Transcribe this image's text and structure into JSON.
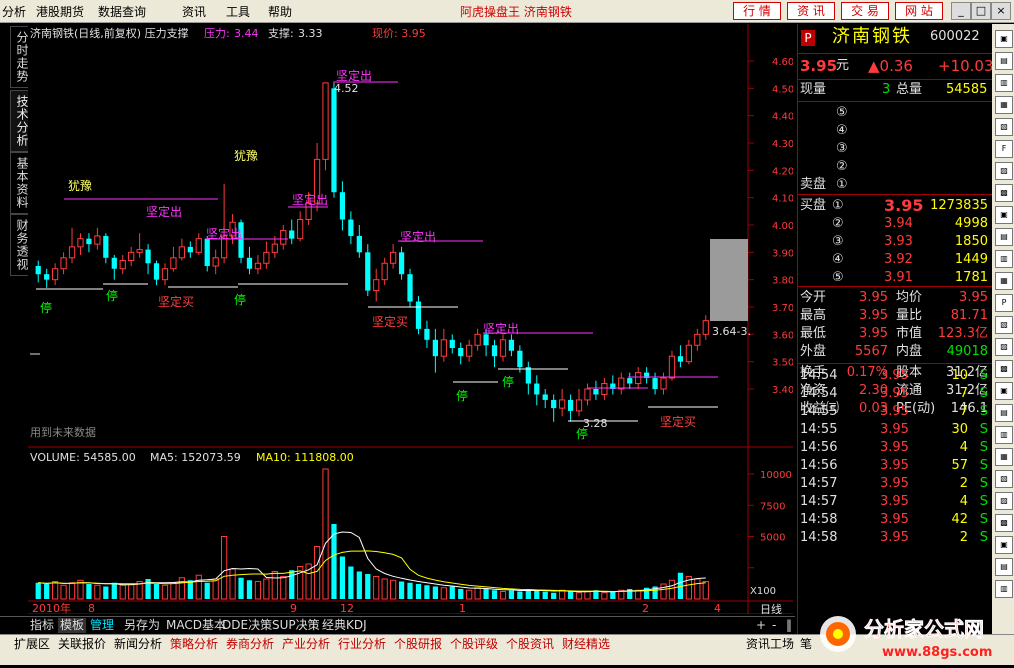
{
  "menu": {
    "items": [
      "分析",
      "港股期货",
      "数据查询",
      "资讯",
      "工具",
      "帮助"
    ],
    "center_title": "阿虎操盘王  济南钢铁",
    "buttons": [
      "行 情",
      "资 讯",
      "交 易",
      "网 站"
    ],
    "window_buttons": [
      "_",
      "□",
      "×"
    ]
  },
  "left_tabs": [
    "分时走势",
    "技术分析",
    "基本资料",
    "财务透视"
  ],
  "chart_header": {
    "title": "济南钢铁(日线,前复权) 压力支撑",
    "pressure_label": "压力:",
    "pressure_value": "3.44",
    "support_label": "支撑:",
    "support_value": "3.33",
    "price_label": "现价: 3.95"
  },
  "chart_annotations": {
    "high_label": "4.52",
    "low_label": "3.28",
    "right_label": "3.64-3.",
    "future_note": "用到未来数据",
    "signals": [
      "坚定出",
      "坚定出",
      "坚定出",
      "坚定出",
      "坚定出",
      "坚定出",
      "坚定买",
      "坚定买",
      "坚定买",
      "停",
      "停",
      "停",
      "停",
      "停",
      "停",
      "犹豫",
      "犹豫"
    ]
  },
  "volume_header": {
    "volume": "VOLUME: 54585.00",
    "ma5": "MA5: 152073.59",
    "ma10": "MA10: 111808.00",
    "scale_label": "X100"
  },
  "time_axis": {
    "labels": [
      "2010年",
      "8",
      "9",
      "12",
      "1",
      "2",
      "4"
    ],
    "period": "日线"
  },
  "chart_data": {
    "type": "candlestick",
    "price_ticks": [
      4.6,
      4.5,
      4.4,
      4.3,
      4.2,
      4.1,
      4.0,
      3.9,
      3.8,
      3.7,
      3.6,
      3.5,
      3.4
    ],
    "volume_ticks": [
      10000,
      7500,
      5000,
      2500
    ],
    "candles": [
      [
        3.85,
        3.82,
        3.87,
        3.79
      ],
      [
        3.82,
        3.8,
        3.84,
        3.77
      ],
      [
        3.8,
        3.84,
        3.86,
        3.78
      ],
      [
        3.84,
        3.88,
        3.9,
        3.82
      ],
      [
        3.88,
        3.92,
        3.99,
        3.86
      ],
      [
        3.92,
        3.95,
        3.97,
        3.89
      ],
      [
        3.95,
        3.93,
        3.97,
        3.9
      ],
      [
        3.93,
        3.96,
        3.99,
        3.91
      ],
      [
        3.96,
        3.88,
        3.97,
        3.86
      ],
      [
        3.88,
        3.84,
        3.89,
        3.8
      ],
      [
        3.84,
        3.87,
        3.89,
        3.82
      ],
      [
        3.87,
        3.9,
        3.92,
        3.85
      ],
      [
        3.9,
        3.91,
        3.97,
        3.88
      ],
      [
        3.91,
        3.86,
        3.93,
        3.82
      ],
      [
        3.86,
        3.8,
        3.87,
        3.78
      ],
      [
        3.8,
        3.84,
        3.86,
        3.78
      ],
      [
        3.84,
        3.88,
        3.92,
        3.83
      ],
      [
        3.88,
        3.92,
        3.95,
        3.87
      ],
      [
        3.92,
        3.9,
        3.94,
        3.88
      ],
      [
        3.9,
        3.95,
        3.97,
        3.89
      ],
      [
        3.95,
        3.85,
        3.96,
        3.83
      ],
      [
        3.85,
        3.88,
        3.91,
        3.82
      ],
      [
        3.88,
        3.96,
        4.15,
        3.86
      ],
      [
        3.96,
        4.01,
        4.04,
        3.93
      ],
      [
        4.01,
        3.88,
        4.02,
        3.86
      ],
      [
        3.88,
        3.84,
        3.92,
        3.82
      ],
      [
        3.84,
        3.86,
        3.89,
        3.82
      ],
      [
        3.86,
        3.9,
        3.94,
        3.84
      ],
      [
        3.9,
        3.93,
        3.96,
        3.88
      ],
      [
        3.93,
        3.98,
        4.0,
        3.91
      ],
      [
        3.98,
        3.95,
        4.02,
        3.93
      ],
      [
        3.95,
        4.02,
        4.05,
        3.94
      ],
      [
        4.02,
        4.08,
        4.12,
        4.0
      ],
      [
        4.08,
        4.24,
        4.3,
        4.05
      ],
      [
        4.24,
        4.52,
        4.52,
        4.2
      ],
      [
        4.5,
        4.12,
        4.52,
        4.1
      ],
      [
        4.12,
        4.02,
        4.16,
        3.98
      ],
      [
        4.02,
        3.96,
        4.05,
        3.93
      ],
      [
        3.96,
        3.9,
        4.0,
        3.88
      ],
      [
        3.9,
        3.76,
        3.93,
        3.74
      ],
      [
        3.76,
        3.8,
        3.84,
        3.72
      ],
      [
        3.8,
        3.86,
        3.88,
        3.78
      ],
      [
        3.86,
        3.9,
        3.93,
        3.84
      ],
      [
        3.9,
        3.82,
        3.92,
        3.8
      ],
      [
        3.82,
        3.72,
        3.84,
        3.7
      ],
      [
        3.72,
        3.62,
        3.74,
        3.6
      ],
      [
        3.62,
        3.58,
        3.65,
        3.55
      ],
      [
        3.58,
        3.52,
        3.62,
        3.46
      ],
      [
        3.52,
        3.58,
        3.62,
        3.5
      ],
      [
        3.58,
        3.55,
        3.6,
        3.53
      ],
      [
        3.55,
        3.52,
        3.57,
        3.49
      ],
      [
        3.52,
        3.56,
        3.58,
        3.5
      ],
      [
        3.56,
        3.6,
        3.62,
        3.54
      ],
      [
        3.6,
        3.56,
        3.62,
        3.52
      ],
      [
        3.56,
        3.52,
        3.58,
        3.48
      ],
      [
        3.52,
        3.58,
        3.6,
        3.5
      ],
      [
        3.58,
        3.54,
        3.6,
        3.52
      ],
      [
        3.54,
        3.48,
        3.56,
        3.46
      ],
      [
        3.48,
        3.42,
        3.5,
        3.38
      ],
      [
        3.42,
        3.38,
        3.45,
        3.34
      ],
      [
        3.38,
        3.36,
        3.4,
        3.33
      ],
      [
        3.36,
        3.33,
        3.38,
        3.28
      ],
      [
        3.33,
        3.36,
        3.4,
        3.3
      ],
      [
        3.36,
        3.32,
        3.38,
        3.28
      ],
      [
        3.32,
        3.36,
        3.4,
        3.3
      ],
      [
        3.36,
        3.4,
        3.42,
        3.34
      ],
      [
        3.4,
        3.38,
        3.43,
        3.36
      ],
      [
        3.38,
        3.42,
        3.44,
        3.36
      ],
      [
        3.42,
        3.4,
        3.45,
        3.38
      ],
      [
        3.4,
        3.44,
        3.46,
        3.38
      ],
      [
        3.44,
        3.42,
        3.46,
        3.4
      ],
      [
        3.42,
        3.46,
        3.48,
        3.4
      ],
      [
        3.46,
        3.44,
        3.48,
        3.42
      ],
      [
        3.44,
        3.4,
        3.46,
        3.38
      ],
      [
        3.4,
        3.44,
        3.46,
        3.38
      ],
      [
        3.44,
        3.52,
        3.54,
        3.43
      ],
      [
        3.52,
        3.5,
        3.56,
        3.48
      ],
      [
        3.5,
        3.56,
        3.58,
        3.49
      ],
      [
        3.56,
        3.6,
        3.62,
        3.54
      ],
      [
        3.6,
        3.65,
        3.67,
        3.58
      ]
    ],
    "volumes": [
      1300,
      1200,
      1400,
      1100,
      1300,
      1500,
      1200,
      1100,
      1000,
      1300,
      1100,
      1200,
      1400,
      1600,
      1200,
      1100,
      1300,
      1700,
      1500,
      1900,
      1300,
      1600,
      5000,
      2400,
      1700,
      1500,
      1400,
      1600,
      2200,
      1800,
      2300,
      2600,
      2800,
      4200,
      10400,
      6000,
      3400,
      2600,
      2200,
      2000,
      1800,
      1600,
      1500,
      1400,
      1300,
      1200,
      1100,
      1000,
      900,
      1000,
      800,
      700,
      900,
      800,
      700,
      600,
      700,
      600,
      800,
      700,
      600,
      500,
      700,
      600,
      500,
      600,
      700,
      500,
      600,
      700,
      800,
      700,
      900,
      1000,
      1200,
      1500,
      2100,
      1800,
      1600,
      1400
    ]
  },
  "quote": {
    "p_label": "P",
    "name": "济南钢铁",
    "code": "600022",
    "price": "3.95",
    "unit": "元",
    "change": "▲0.36",
    "change_pct": "+10.03",
    "now_vol_label": "现量",
    "now_vol": "3",
    "total_vol_label": "总量",
    "total_vol": "54585",
    "sell_label": "卖盘",
    "buy_label": "买盘",
    "sell_levels": [
      "⑤",
      "④",
      "③",
      "②",
      "①"
    ],
    "buy_levels": [
      {
        "lvl": "①",
        "price": "3.95",
        "vol": "1273835"
      },
      {
        "lvl": "②",
        "price": "3.94",
        "vol": "4998"
      },
      {
        "lvl": "③",
        "price": "3.93",
        "vol": "1850"
      },
      {
        "lvl": "④",
        "price": "3.92",
        "vol": "1449"
      },
      {
        "lvl": "⑤",
        "price": "3.91",
        "vol": "1781"
      }
    ],
    "stats": [
      {
        "l1": "今开",
        "v1": "3.95",
        "l2": "均价",
        "v2": "3.95"
      },
      {
        "l1": "最高",
        "v1": "3.95",
        "l2": "量比",
        "v2": "81.71"
      },
      {
        "l1": "最低",
        "v1": "3.95",
        "l2": "市值",
        "v2": "123.3亿"
      },
      {
        "l1": "外盘",
        "v1": "5567",
        "l2": "内盘",
        "v2": "49018"
      },
      {
        "l1": "换手",
        "v1": "0.17%",
        "l2": "股本",
        "v2": "31.2亿"
      },
      {
        "l1": "净资",
        "v1": "2.30",
        "l2": "流通",
        "v2": "31.2亿"
      },
      {
        "l1": "收益㈢",
        "v1": "0.03",
        "l2": "PE(动)",
        "v2": "146.1"
      }
    ],
    "ticks": [
      {
        "t": "14:54",
        "p": "3.95",
        "v": "10",
        "s": "S"
      },
      {
        "t": "14:54",
        "p": "3.95",
        "v": "7",
        "s": "S"
      },
      {
        "t": "14:55",
        "p": "3.95",
        "v": "7",
        "s": "S"
      },
      {
        "t": "14:55",
        "p": "3.95",
        "v": "30",
        "s": "S"
      },
      {
        "t": "14:56",
        "p": "3.95",
        "v": "4",
        "s": "S"
      },
      {
        "t": "14:56",
        "p": "3.95",
        "v": "57",
        "s": "S"
      },
      {
        "t": "14:57",
        "p": "3.95",
        "v": "2",
        "s": "S"
      },
      {
        "t": "14:57",
        "p": "3.95",
        "v": "4",
        "s": "S"
      },
      {
        "t": "14:58",
        "p": "3.95",
        "v": "42",
        "s": "S"
      },
      {
        "t": "14:58",
        "p": "3.95",
        "v": "2",
        "s": "S"
      }
    ]
  },
  "tabbar": [
    "指标",
    "模板",
    "管理",
    "另存为",
    "MACD基本",
    "DDE决策",
    "SUP决策",
    "经典KDJ"
  ],
  "tabbar_right": [
    "+",
    "-",
    "‖"
  ],
  "navbar": [
    "扩展区",
    "关联报价",
    "新闻分析",
    "策略分析",
    "券商分析",
    "产业分析",
    "行业分析",
    "个股研报",
    "个股评级",
    "个股资讯",
    "财经精选"
  ],
  "navbar_right": [
    "资讯工场",
    "笔"
  ],
  "logo": {
    "text": "分析家公式网",
    "url": "www.88gs.com"
  },
  "colors": {
    "up": "#ff3b3b",
    "down": "#00ffff",
    "pressure": "#ff33ff",
    "support": "#ffffff"
  }
}
